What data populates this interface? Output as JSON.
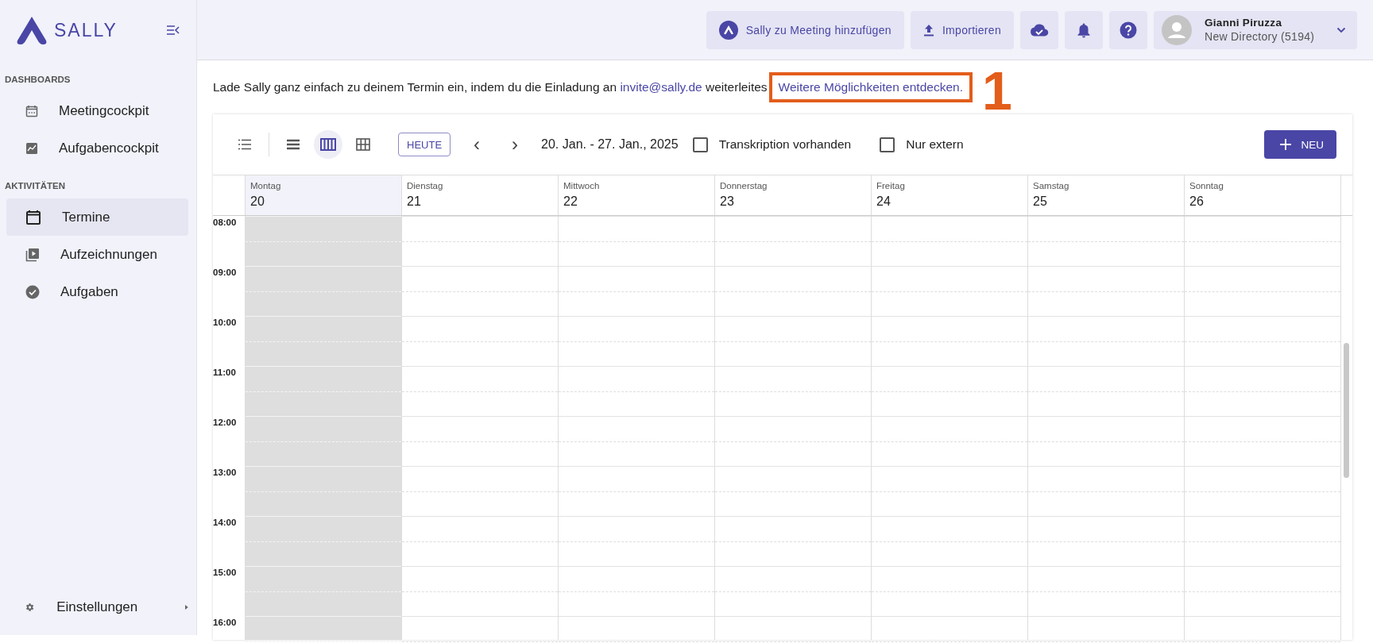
{
  "sidebar": {
    "logo": "SALLY",
    "sections": [
      {
        "title": "DASHBOARDS",
        "items": [
          {
            "label": "Meetingcockpit",
            "kind": "calendar-small",
            "selected": false
          },
          {
            "label": "Aufgabencockpit",
            "kind": "chart",
            "selected": false
          }
        ]
      },
      {
        "title": "AKTIVITÄTEN",
        "items": [
          {
            "label": "Termine",
            "kind": "calendar",
            "selected": true
          },
          {
            "label": "Aufzeichnungen",
            "kind": "video",
            "selected": false
          },
          {
            "label": "Aufgaben",
            "kind": "check",
            "selected": false
          }
        ]
      }
    ],
    "footer": {
      "label": "Einstellungen"
    }
  },
  "header": {
    "add_button": "Sally zu Meeting hinzufügen",
    "import_button": "Importieren",
    "user": {
      "name": "Gianni Piruzza",
      "directory": "New Directory (5194)"
    }
  },
  "info": {
    "text": "Lade Sally ganz einfach zu deinem Termin ein, indem du die Einladung an",
    "email": "invite@sally.de",
    "after": "weiterleites",
    "link": "Weitere Möglichkeiten entdecken.",
    "callout_number": "1"
  },
  "toolbar": {
    "views": [
      {
        "kind": "list",
        "selected": false
      },
      {
        "kind": "day",
        "selected": false
      },
      {
        "kind": "week",
        "selected": true
      },
      {
        "kind": "month",
        "selected": false
      }
    ],
    "today_button": "HEUTE",
    "prev": "‹",
    "next": "›",
    "range": "20. Jan. - 27. Jan., 2025",
    "filters": [
      {
        "label": "Transkription vorhanden",
        "checked": false
      },
      {
        "label": "Nur extern",
        "checked": false
      }
    ],
    "new_button": "NEU"
  },
  "days": [
    {
      "name": "Montag",
      "date": "20",
      "selected": true
    },
    {
      "name": "Dienstag",
      "date": "21",
      "selected": false
    },
    {
      "name": "Mittwoch",
      "date": "22",
      "selected": false
    },
    {
      "name": "Donnerstag",
      "date": "23",
      "selected": false
    },
    {
      "name": "Freitag",
      "date": "24",
      "selected": false
    },
    {
      "name": "Samstag",
      "date": "25",
      "selected": false
    },
    {
      "name": "Sonntag",
      "date": "26",
      "selected": false
    }
  ],
  "hours": [
    "08:00",
    "09:00",
    "10:00",
    "11:00",
    "12:00",
    "13:00",
    "14:00",
    "15:00",
    "16:00"
  ]
}
